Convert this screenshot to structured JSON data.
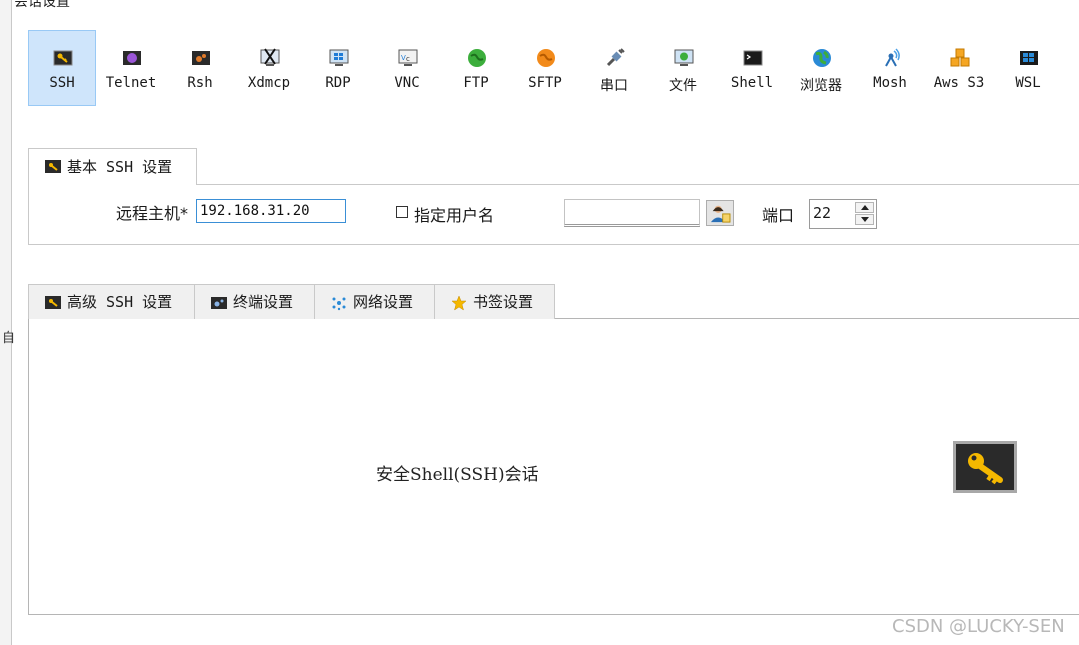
{
  "window": {
    "title": "会话设置",
    "left_edge_char": "自"
  },
  "session_types": [
    {
      "label": "SSH",
      "icon": "ssh-key-icon",
      "active": true
    },
    {
      "label": "Telnet",
      "icon": "telnet-icon"
    },
    {
      "label": "Rsh",
      "icon": "rsh-icon"
    },
    {
      "label": "Xdmcp",
      "icon": "xdmcp-icon"
    },
    {
      "label": "RDP",
      "icon": "rdp-monitor-icon"
    },
    {
      "label": "VNC",
      "icon": "vnc-icon"
    },
    {
      "label": "FTP",
      "icon": "ftp-globe-icon"
    },
    {
      "label": "SFTP",
      "icon": "sftp-globe-icon"
    },
    {
      "label": "串口",
      "icon": "serial-plug-icon"
    },
    {
      "label": "文件",
      "icon": "file-monitor-icon"
    },
    {
      "label": "Shell",
      "icon": "shell-terminal-icon"
    },
    {
      "label": "浏览器",
      "icon": "browser-globe-icon"
    },
    {
      "label": "Mosh",
      "icon": "mosh-antenna-icon"
    },
    {
      "label": "Aws S3",
      "icon": "aws-s3-cubes-icon"
    },
    {
      "label": "WSL",
      "icon": "windows-icon"
    }
  ],
  "basic_tab": {
    "label": "基本 SSH 设置"
  },
  "basic": {
    "host_label": "远程主机*",
    "host_value": "192.168.31.20",
    "user_checkbox_label": "指定用户名",
    "user_value": "",
    "port_label": "端口",
    "port_value": "22"
  },
  "lower_tabs": [
    {
      "label": "高级 SSH 设置",
      "icon": "ssh-key-icon"
    },
    {
      "label": "终端设置",
      "icon": "terminal-settings-icon"
    },
    {
      "label": "网络设置",
      "icon": "network-icon"
    },
    {
      "label": "书签设置",
      "icon": "star-icon"
    }
  ],
  "lower_panel": {
    "description": "安全Shell(SSH)会话"
  },
  "watermark": "CSDN @LUCKY-SEN",
  "colors": {
    "active_tab_bg": "#cfe5fb",
    "active_tab_border": "#99c9f5",
    "input_focus": "#3a8fd6",
    "key_gold": "#f5b800"
  }
}
